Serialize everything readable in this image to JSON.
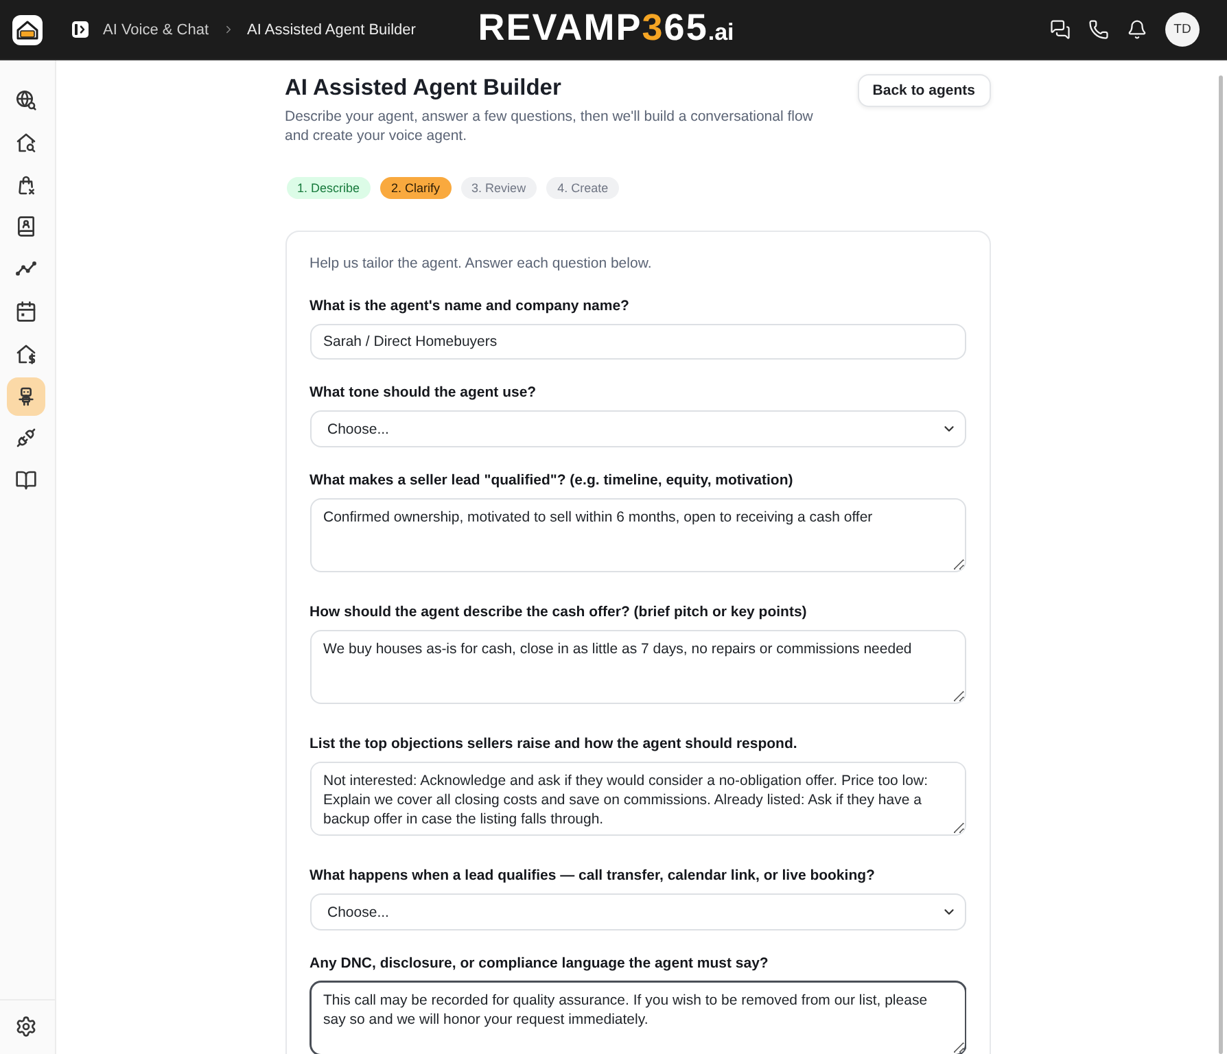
{
  "header": {
    "breadcrumb": [
      {
        "label": "AI Voice & Chat"
      },
      {
        "label": "AI Assisted Agent Builder"
      }
    ],
    "logo": [
      {
        "text": "REVAMP",
        "kind": "word"
      },
      {
        "text": "3",
        "kind": "accent"
      },
      {
        "text": "65",
        "kind": "word"
      },
      {
        "text": ".ai",
        "kind": "suffix"
      }
    ],
    "user": {
      "initials": "TD"
    }
  },
  "sidebar": {
    "items": [
      {
        "selected": false
      },
      {
        "selected": false
      },
      {
        "selected": false
      },
      {
        "selected": false
      },
      {
        "selected": false
      },
      {
        "selected": false
      },
      {
        "selected": false
      },
      {
        "selected": true
      },
      {
        "selected": false
      },
      {
        "selected": false
      }
    ]
  },
  "page": {
    "title": "AI Assisted Agent Builder",
    "subtitle": "Describe your agent, answer a few questions, then we'll build a conversational flow and create your voice agent.",
    "back_button": "Back to agents"
  },
  "steps": [
    {
      "label": "1. Describe",
      "done": true,
      "selected": false
    },
    {
      "label": "2. Clarify",
      "done": false,
      "selected": true
    },
    {
      "label": "3. Review",
      "done": false,
      "selected": false
    },
    {
      "label": "4. Create",
      "done": false,
      "selected": false
    }
  ],
  "form": {
    "intro": "Help us tailor the agent. Answer each question below.",
    "questions": [
      {
        "kind": "text",
        "label": "What is the agent's name and company name?",
        "value": "Sarah / Direct Homebuyers",
        "focused": false
      },
      {
        "kind": "select",
        "label": "What tone should the agent use?",
        "value": "Choose...",
        "focused": false
      },
      {
        "kind": "textarea",
        "label": "What makes a seller lead \"qualified\"? (e.g. timeline, equity, motivation)",
        "value": "Confirmed ownership, motivated to sell within 6 months, open to receiving a cash offer",
        "focused": false
      },
      {
        "kind": "textarea",
        "label": "How should the agent describe the cash offer? (brief pitch or key points)",
        "value": "We buy houses as-is for cash, close in as little as 7 days, no repairs or commissions needed",
        "focused": false
      },
      {
        "kind": "textarea",
        "label": "List the top objections sellers raise and how the agent should respond.",
        "value": "Not interested: Acknowledge and ask if they would consider a no-obligation offer. Price too low: Explain we cover all closing costs and save on commissions. Already listed: Ask if they have a backup offer in case the listing falls through.",
        "focused": false
      },
      {
        "kind": "select",
        "label": "What happens when a lead qualifies — call transfer, calendar link, or live booking?",
        "value": "Choose...",
        "focused": false
      },
      {
        "kind": "textarea",
        "label": "Any DNC, disclosure, or compliance language the agent must say?",
        "value": "This call may be recorded for quality assurance. If you wish to be removed from our list, please say so and we will honor your request immediately.",
        "focused": true
      }
    ]
  }
}
